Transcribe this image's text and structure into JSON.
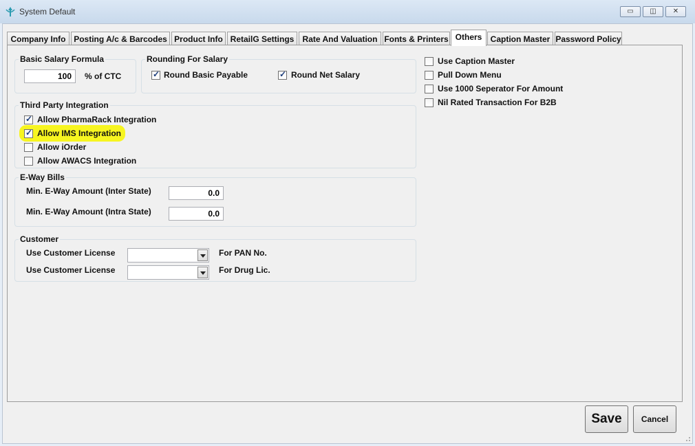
{
  "window": {
    "title": "System Default",
    "btn_minimize": "▭",
    "btn_restore": "◫",
    "btn_close": "✕"
  },
  "tabs": [
    {
      "label": "Company Info"
    },
    {
      "label": "Posting A/c & Barcodes"
    },
    {
      "label": "Product Info"
    },
    {
      "label": "RetailG Settings"
    },
    {
      "label": "Rate And Valuation"
    },
    {
      "label": "Fonts & Printers"
    },
    {
      "label": "Others"
    },
    {
      "label": "Caption Master"
    },
    {
      "label": "Password Policy"
    }
  ],
  "active_tab": "Others",
  "basic_salary": {
    "legend": "Basic Salary Formula",
    "value": "100",
    "suffix": "% of CTC"
  },
  "rounding": {
    "legend": "Rounding For Salary",
    "items": [
      {
        "label": "Round Basic Payable",
        "checked": true
      },
      {
        "label": "Round Net Salary",
        "checked": true
      }
    ]
  },
  "third_party": {
    "legend": "Third Party Integration",
    "items": [
      {
        "label": "Allow PharmaRack Integration",
        "checked": true
      },
      {
        "label": "Allow IMS Integration",
        "checked": true
      },
      {
        "label": "Allow iOrder",
        "checked": false
      },
      {
        "label": "Allow AWACS Integration",
        "checked": false
      }
    ]
  },
  "eway": {
    "legend": "E-Way Bills",
    "inter_label": "Min. E-Way Amount (Inter State)",
    "inter_value": "0.0",
    "intra_label": "Min. E-Way Amount (Intra State)",
    "intra_value": "0.0"
  },
  "customer": {
    "legend": "Customer",
    "row1_label": "Use Customer License",
    "row1_suffix": "For PAN No.",
    "row1_value": "",
    "row2_label": "Use Customer License",
    "row2_suffix": "For Drug Lic.",
    "row2_value": ""
  },
  "right_options": [
    {
      "label": "Use Caption Master",
      "checked": false
    },
    {
      "label": "Pull Down Menu",
      "checked": false
    },
    {
      "label": "Use 1000 Seperator For Amount",
      "checked": false
    },
    {
      "label": "Nil Rated Transaction For B2B",
      "checked": false
    }
  ],
  "buttons": {
    "save": "Save",
    "cancel": "Cancel"
  },
  "check_glyph": "✓",
  "colors": {
    "highlight": "#f7f520"
  }
}
